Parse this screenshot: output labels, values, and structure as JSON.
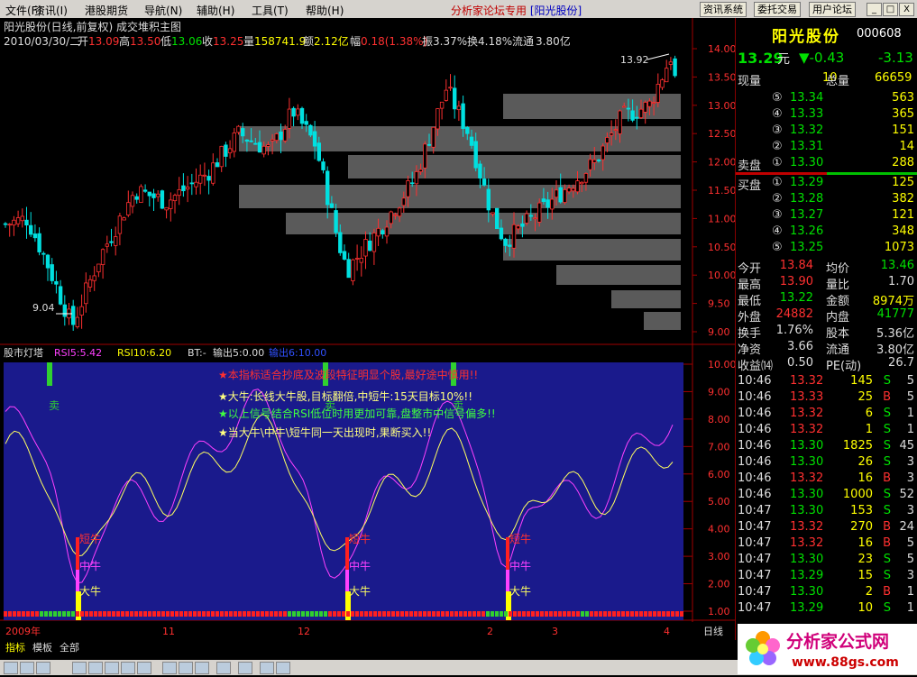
{
  "menu": {
    "items": [
      "文件(F)",
      "资讯(I)",
      "港股期货",
      "导航(N)",
      "辅助(H)",
      "工具(T)",
      "帮助(H)"
    ],
    "forum": "分析家论坛专用",
    "stock_tag": "[阳光股份]",
    "buttons": [
      "资讯系统",
      "委托交易",
      "用户论坛"
    ],
    "win": [
      "_",
      "□",
      "X"
    ]
  },
  "header": {
    "title": "阳光股份(日线,前复权) 成交堆积主图",
    "date": "2010/03/30/二",
    "open_label": "开",
    "open": "13.09",
    "high_label": "高",
    "high": "13.50",
    "low_label": "低",
    "low": "13.06",
    "close_label": "收",
    "close": "13.25",
    "vol_label": "量",
    "vol": "158741.9",
    "amt_label": "额",
    "amt": "2.12亿",
    "chg_label": "幅",
    "chg": "0.18(1.38%)",
    "amp_label": "振",
    "amp": "3.37%",
    "turn_label": "换",
    "turn": "4.18%",
    "float_label": "流通",
    "float": "3.80亿"
  },
  "main_axis": [
    "14.00",
    "13.50",
    "13.00",
    "12.50",
    "12.00",
    "11.50",
    "11.00",
    "10.50",
    "10.00",
    "9.50",
    "9.00"
  ],
  "annotations": {
    "high_mark": "13.92",
    "low_mark": "9.04"
  },
  "indicator": {
    "name": "股市灯塔",
    "rsi5": "RSI5:5.42",
    "rsi10": "RSI10:6.20",
    "bt": "BT:-",
    "out1": "输出5:0.00",
    "out2": "输出6:10.00",
    "axis": [
      "10.00",
      "9.00",
      "8.00",
      "7.00",
      "6.00",
      "5.00",
      "4.00",
      "3.00",
      "2.00",
      "1.00"
    ],
    "notes": [
      "★本指标适合抄底及波段特征明显个股,最好途中慎用!!",
      "★大牛:长线大牛股,目标翻倍,中短牛:15天目标10%!!",
      "★以上信号结合RSI低位时用更加可靠,盘整市中信号偏多!!",
      "★当大牛\\中牛\\短牛同一天出现时,果断买入!!"
    ],
    "signals": {
      "sell": "卖",
      "short": "短牛",
      "mid": "中牛",
      "big": "大牛"
    }
  },
  "timeaxis": {
    "labels": [
      "2009年",
      "11",
      "12",
      "2",
      "3",
      "4"
    ],
    "period": "日线"
  },
  "tabs": [
    "指标",
    "模板",
    "全部"
  ],
  "quote": {
    "name": "阳光股份",
    "code": "000608",
    "price": "13.29",
    "unit": "元",
    "change": "▼-0.43",
    "pct": "-3.13",
    "now_label": "现量",
    "now": "10",
    "total_label": "总量",
    "total": "66659",
    "sell_label": "卖盘",
    "buy_label": "买盘",
    "asks": [
      {
        "lvl": "⑤",
        "price": "13.34",
        "vol": "563"
      },
      {
        "lvl": "④",
        "price": "13.33",
        "vol": "365"
      },
      {
        "lvl": "③",
        "price": "13.32",
        "vol": "151"
      },
      {
        "lvl": "②",
        "price": "13.31",
        "vol": "14"
      },
      {
        "lvl": "①",
        "price": "13.30",
        "vol": "288"
      }
    ],
    "bids": [
      {
        "lvl": "①",
        "price": "13.29",
        "vol": "125"
      },
      {
        "lvl": "②",
        "price": "13.28",
        "vol": "382"
      },
      {
        "lvl": "③",
        "price": "13.27",
        "vol": "121"
      },
      {
        "lvl": "④",
        "price": "13.26",
        "vol": "348"
      },
      {
        "lvl": "⑤",
        "price": "13.25",
        "vol": "1073"
      }
    ],
    "stats": [
      {
        "l1": "今开",
        "v1": "13.84",
        "c1": "r",
        "l2": "均价",
        "v2": "13.46",
        "c2": "g"
      },
      {
        "l1": "最高",
        "v1": "13.90",
        "c1": "r",
        "l2": "量比",
        "v2": "1.70",
        "c2": "w"
      },
      {
        "l1": "最低",
        "v1": "13.22",
        "c1": "g",
        "l2": "金额",
        "v2": "8974万",
        "c2": "y"
      },
      {
        "l1": "外盘",
        "v1": "24882",
        "c1": "r",
        "l2": "内盘",
        "v2": "41777",
        "c2": "g"
      },
      {
        "l1": "换手",
        "v1": "1.76%",
        "c1": "w",
        "l2": "股本",
        "v2": "5.36亿",
        "c2": "w"
      },
      {
        "l1": "净资",
        "v1": "3.66",
        "c1": "w",
        "l2": "流通",
        "v2": "3.80亿",
        "c2": "w"
      },
      {
        "l1": "收益⒁",
        "v1": "0.50",
        "c1": "w",
        "l2": "PE(动)",
        "v2": "26.7",
        "c2": "w"
      }
    ],
    "ticks": [
      {
        "t": "10:46",
        "p": "13.32",
        "v": "145",
        "s": "S",
        "n": "5"
      },
      {
        "t": "10:46",
        "p": "13.33",
        "v": "25",
        "s": "B",
        "n": "5"
      },
      {
        "t": "10:46",
        "p": "13.32",
        "v": "6",
        "s": "S",
        "n": "1"
      },
      {
        "t": "10:46",
        "p": "13.32",
        "v": "1",
        "s": "S",
        "n": "1"
      },
      {
        "t": "10:46",
        "p": "13.30",
        "v": "1825",
        "s": "S",
        "n": "45"
      },
      {
        "t": "10:46",
        "p": "13.30",
        "v": "26",
        "s": "S",
        "n": "3"
      },
      {
        "t": "10:46",
        "p": "13.32",
        "v": "16",
        "s": "B",
        "n": "3"
      },
      {
        "t": "10:46",
        "p": "13.30",
        "v": "1000",
        "s": "S",
        "n": "52"
      },
      {
        "t": "10:47",
        "p": "13.30",
        "v": "153",
        "s": "S",
        "n": "3"
      },
      {
        "t": "10:47",
        "p": "13.32",
        "v": "270",
        "s": "B",
        "n": "24"
      },
      {
        "t": "10:47",
        "p": "13.32",
        "v": "16",
        "s": "B",
        "n": "5"
      },
      {
        "t": "10:47",
        "p": "13.30",
        "v": "23",
        "s": "S",
        "n": "5"
      },
      {
        "t": "10:47",
        "p": "13.29",
        "v": "15",
        "s": "S",
        "n": "3"
      },
      {
        "t": "10:47",
        "p": "13.30",
        "v": "2",
        "s": "B",
        "n": "1"
      },
      {
        "t": "10:47",
        "p": "13.29",
        "v": "10",
        "s": "S",
        "n": "1"
      }
    ]
  },
  "logo": {
    "text": "分析家公式网",
    "url": "www.88gs.com"
  },
  "colors": {
    "up": "#ff3030",
    "down": "#00e0e0",
    "panel_bg": "#1a1a8c"
  }
}
